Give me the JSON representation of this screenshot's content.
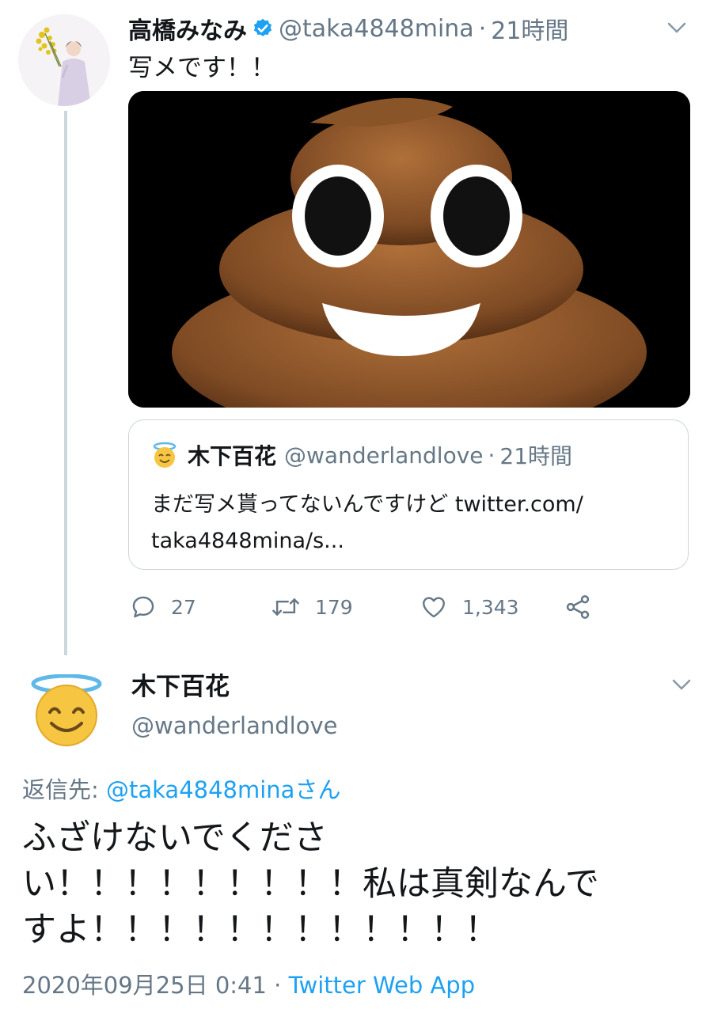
{
  "tweet1": {
    "display_name": "高橋みなみ",
    "handle": "@taka4848mina",
    "separator": "·",
    "time": "21時間",
    "text": "写メです！！",
    "verified": true,
    "icons": [
      "verified-badge-icon",
      "chevron-down-icon"
    ],
    "media_alt_icon": "pile-of-poo-emoji",
    "quote": {
      "display_name": "木下百花",
      "handle": "@wanderlandlove",
      "separator": "·",
      "time": "21時間",
      "text": "まだ写メ貰ってないんですけど twitter.com/\ntaka4848mina/s...",
      "avatar_icon": "smiling-face-with-halo-emoji"
    },
    "actions": {
      "reply_count": "27",
      "retweet_count": "179",
      "like_count": "1,343",
      "icons": [
        "reply-icon",
        "retweet-icon",
        "like-icon",
        "share-icon"
      ]
    }
  },
  "tweet2": {
    "display_name": "木下百花",
    "handle": "@wanderlandlove",
    "avatar_icon": "smiling-face-with-halo-emoji",
    "reply_to_prefix": "返信先: ",
    "reply_to_mention": "@taka4848minaさん",
    "text": "ふざけないでくださ\nい！！！！！！！！！私は真剣なんで\nすよ！！！！！！！！！！！！",
    "timestamp": "2020年09月25日 0:41",
    "separator": " · ",
    "source": "Twitter Web App"
  },
  "colors": {
    "text_primary": "#14171a",
    "text_secondary": "#657786",
    "link": "#1da1f2",
    "border": "#ccd6dd",
    "media_background": "#000000"
  }
}
